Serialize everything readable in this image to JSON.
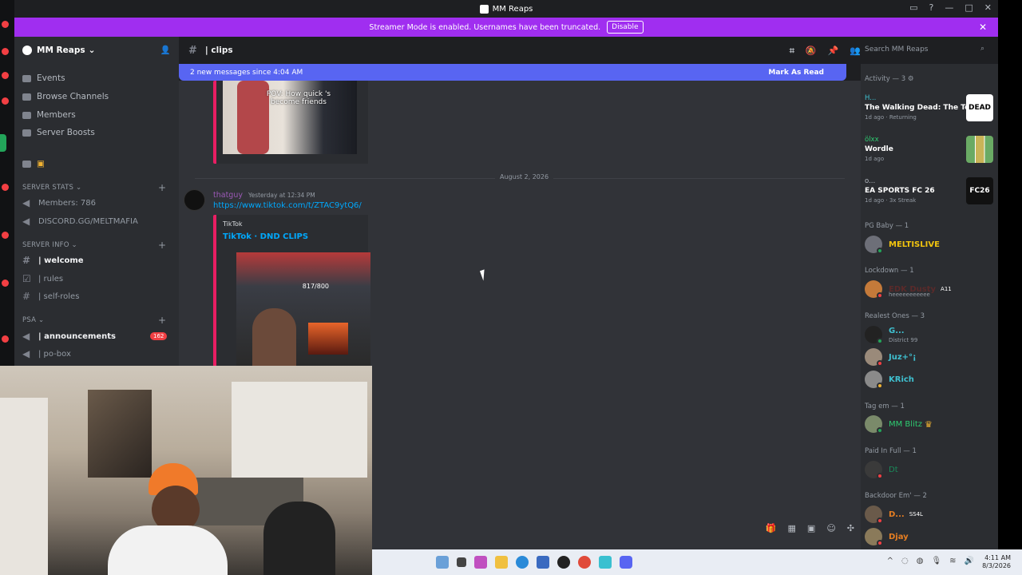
{
  "window": {
    "title": "MM Reaps"
  },
  "banner": {
    "text": "Streamer Mode is enabled. Usernames have been truncated.",
    "disable_label": "Disable"
  },
  "server": {
    "name": "MM Reaps",
    "nav": [
      "Events",
      "Browse Channels",
      "Members",
      "Server Boosts"
    ],
    "categories": {
      "stats": "SERVER STATS",
      "info": "SERVER INFO",
      "psa": "PSA"
    },
    "stats_channels": [
      "Members: 786",
      "DISCORD.GG/MELTMAFIA"
    ],
    "info_channels": [
      "| welcome",
      "| rules",
      "| self-roles"
    ],
    "psa_channels": [
      "| announcements",
      "| po-box"
    ],
    "announcements_badge": "162"
  },
  "channel": {
    "name": "| clips"
  },
  "search": {
    "placeholder": "Search MM Reaps"
  },
  "new_messages": {
    "text": "2 new messages since 4:04 AM",
    "mark_read": "Mark As Read"
  },
  "chat": {
    "top_embed_caption": "POV: How quick   's become friends",
    "date_divider": "August 2, 2026",
    "message": {
      "author": "thatguy",
      "timestamp": "Yesterday at 12:34 PM",
      "link": "https://www.tiktok.com/t/ZTAC9ytQ6/",
      "embed_provider": "TikTok",
      "embed_title": "TikTok · DND CLIPS",
      "thumb_counter": "817/800"
    }
  },
  "members": {
    "activity_header": "Activity — 3",
    "activities": [
      {
        "user": "H...",
        "game": "The Walking Dead: The Tell...",
        "meta": "1d ago  · Returning",
        "art": "DEAD"
      },
      {
        "user": "ölxx",
        "game": "Wordle",
        "meta": "1d ago",
        "art": ""
      },
      {
        "user": "o...",
        "game": "EA SPORTS FC 26",
        "meta": "1d ago  · 3x Streak",
        "art": "FC26"
      }
    ],
    "groups": [
      {
        "label": "PG Baby — 1",
        "members": [
          {
            "name": "MELTISLIVE",
            "color": "#f1c40f",
            "status": "#23a55a",
            "sub": ""
          }
        ]
      },
      {
        "label": "Lockdown — 1",
        "members": [
          {
            "name": "EDK Dusty",
            "color": "#6a2a2a",
            "status": "#f23f43",
            "sub": "heeeeeeeeeee",
            "tag": "A11"
          }
        ]
      },
      {
        "label": "Realest Ones — 3",
        "members": [
          {
            "name": "G...",
            "color": "#3fc0d0",
            "status": "#23a55a",
            "sub": "District 99"
          },
          {
            "name": "Juz+°¡",
            "color": "#3fc0d0",
            "status": "#f23f43",
            "sub": ""
          },
          {
            "name": "KRich",
            "color": "#3fc0d0",
            "status": "#f0b232",
            "sub": ""
          }
        ]
      },
      {
        "label": "Tag em — 1",
        "members": [
          {
            "name": "MM Blitz",
            "color": "#2ecc71",
            "status": "#23a55a",
            "sub": ""
          }
        ]
      },
      {
        "label": "Paid In Full — 1",
        "members": [
          {
            "name": "Dt",
            "color": "#1a8a5a",
            "status": "#f23f43",
            "sub": ""
          }
        ]
      },
      {
        "label": "Backdoor Em' — 2",
        "members": [
          {
            "name": "D...",
            "color": "#e67e22",
            "status": "#f23f43",
            "sub": "",
            "tag": "SS4L"
          },
          {
            "name": "Djay",
            "color": "#e67e22",
            "status": "#f23f43",
            "sub": ""
          }
        ]
      }
    ]
  },
  "taskbar": {
    "time": "4:11 AM",
    "date": "8/3/2026"
  }
}
